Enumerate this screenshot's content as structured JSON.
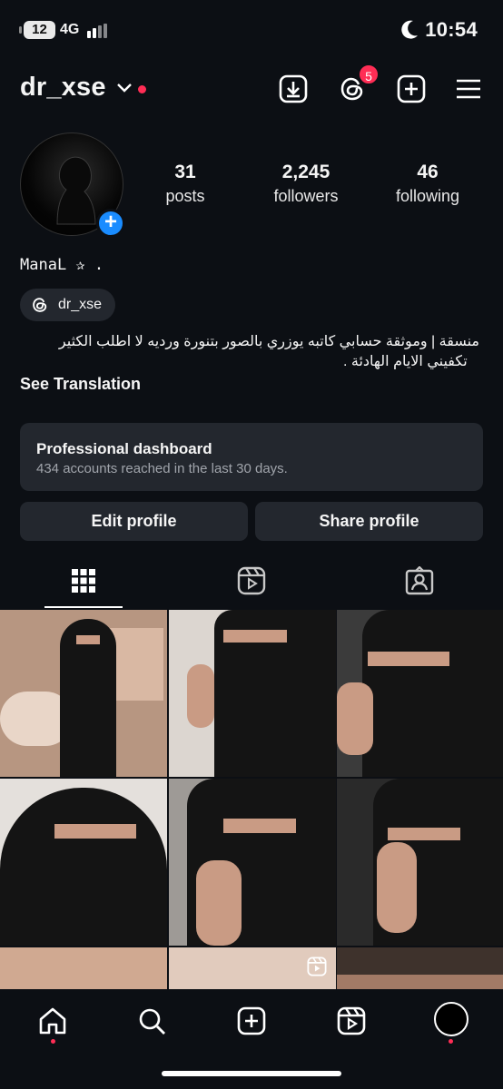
{
  "status": {
    "battery": "12",
    "network": "4G",
    "time": "10:54"
  },
  "header": {
    "username": "dr_xse",
    "threads_badge": "5",
    "icons": [
      "download-icon",
      "threads-icon",
      "create-icon",
      "menu-icon"
    ]
  },
  "profile": {
    "stats": [
      {
        "value": "31",
        "label": "posts"
      },
      {
        "value": "2,245",
        "label": "followers"
      },
      {
        "value": "46",
        "label": "following"
      }
    ],
    "full_name": "ManaL ✰ .",
    "threads_handle": "dr_xse",
    "bio_line1": "منسقة | وموثقة حسابي كاتبه يوزري بالصور بتنورة ورديه لا اطلب الكثير",
    "bio_line2": "تكفيني الايام الهادئة .",
    "see_translation": "See Translation"
  },
  "dashboard": {
    "title": "Professional dashboard",
    "subtitle": "434 accounts reached in the last 30 days."
  },
  "actions": {
    "edit": "Edit profile",
    "share": "Share profile"
  },
  "tabs": [
    "grid-icon",
    "reels-icon",
    "tagged-icon"
  ],
  "bottom_nav": [
    "home-icon",
    "search-icon",
    "create-icon",
    "reels-icon",
    "profile-avatar"
  ]
}
